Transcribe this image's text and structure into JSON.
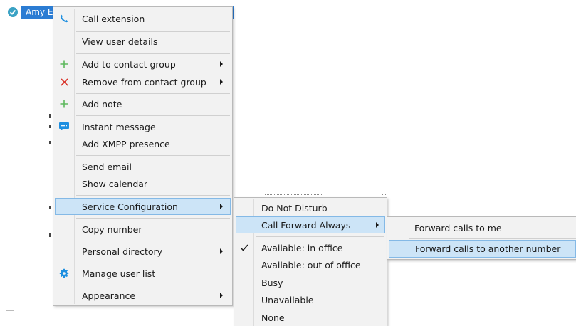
{
  "user_chip": {
    "name": "Amy E"
  },
  "context_menu": {
    "items": [
      {
        "label": "Call extension",
        "icon": "phone-icon",
        "has_submenu": false
      },
      {
        "label": "View user details",
        "has_submenu": false
      },
      {
        "label": "Add to contact group",
        "icon": "plus-icon",
        "has_submenu": true
      },
      {
        "label": "Remove from contact group",
        "icon": "remove-icon",
        "has_submenu": true
      },
      {
        "label": "Add note",
        "icon": "plus-icon",
        "has_submenu": false
      },
      {
        "label": "Instant message",
        "icon": "chat-bubble-icon",
        "has_submenu": false
      },
      {
        "label": "Add XMPP presence",
        "has_submenu": false
      },
      {
        "label": "Send email",
        "has_submenu": false
      },
      {
        "label": "Show calendar",
        "has_submenu": false
      },
      {
        "label": "Service Configuration",
        "has_submenu": true,
        "highlighted": true
      },
      {
        "label": "Copy number",
        "has_submenu": false
      },
      {
        "label": "Personal directory",
        "has_submenu": true
      },
      {
        "label": "Manage user list",
        "icon": "gear-icon",
        "has_submenu": false
      },
      {
        "label": "Appearance",
        "has_submenu": true
      }
    ]
  },
  "service_submenu": {
    "items": [
      {
        "label": "Do Not Disturb",
        "has_submenu": false
      },
      {
        "label": "Call Forward Always",
        "has_submenu": true,
        "highlighted": true
      },
      {
        "label": "Available: in office",
        "checked": true
      },
      {
        "label": "Available: out of office"
      },
      {
        "label": "Busy"
      },
      {
        "label": "Unavailable"
      },
      {
        "label": "None"
      }
    ]
  },
  "forward_submenu": {
    "items": [
      {
        "label": "Forward calls to me"
      },
      {
        "label": "Forward calls to another number",
        "highlighted": true
      }
    ]
  },
  "colors": {
    "highlight_bg": "#cce4f7",
    "highlight_border": "#84b9e6",
    "chip_bg": "#2b7cd3",
    "status_teal": "#3aa2c4",
    "icon_green": "#5cb85c",
    "icon_red": "#d9342b",
    "icon_blue": "#1e8fe0"
  }
}
